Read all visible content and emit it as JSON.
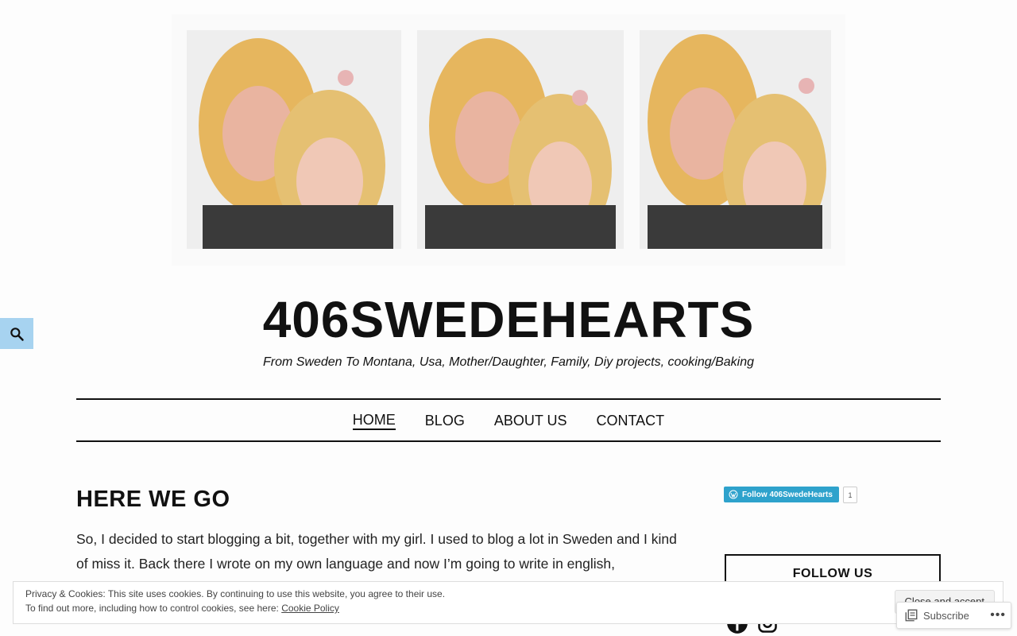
{
  "site": {
    "title": "406SWEDEHEARTS",
    "description": "From Sweden To Montana, Usa, Mother/Daughter, Family, Diy projects, cooking/Baking"
  },
  "nav": {
    "items": [
      {
        "label": "HOME",
        "current": true
      },
      {
        "label": "BLOG",
        "current": false
      },
      {
        "label": "ABOUT US",
        "current": false
      },
      {
        "label": "CONTACT",
        "current": false
      }
    ]
  },
  "post": {
    "title": "HERE WE GO",
    "body": "So, I decided to start blogging a bit, together with my girl. I used to blog a lot in Sweden and I kind of miss it. Back there I wrote on my own language and now I’m going to write in english,"
  },
  "sidebar": {
    "follow_button": "Follow 406SwedeHearts",
    "follow_count": "1",
    "follow_us_heading": "FOLLOW US",
    "social_icons": [
      "facebook-icon",
      "instagram-icon"
    ]
  },
  "cookie": {
    "line1": "Privacy & Cookies: This site uses cookies. By continuing to use this website, you agree to their use.",
    "line2_prefix": "To find out more, including how to control cookies, see here: ",
    "policy_link": "Cookie Policy",
    "close_label": "Close and accept"
  },
  "subscribe": {
    "label": "Subscribe",
    "more": "•••"
  },
  "colors": {
    "search_tab": "#a7d3f0",
    "follow_button": "#2ea2cc"
  }
}
